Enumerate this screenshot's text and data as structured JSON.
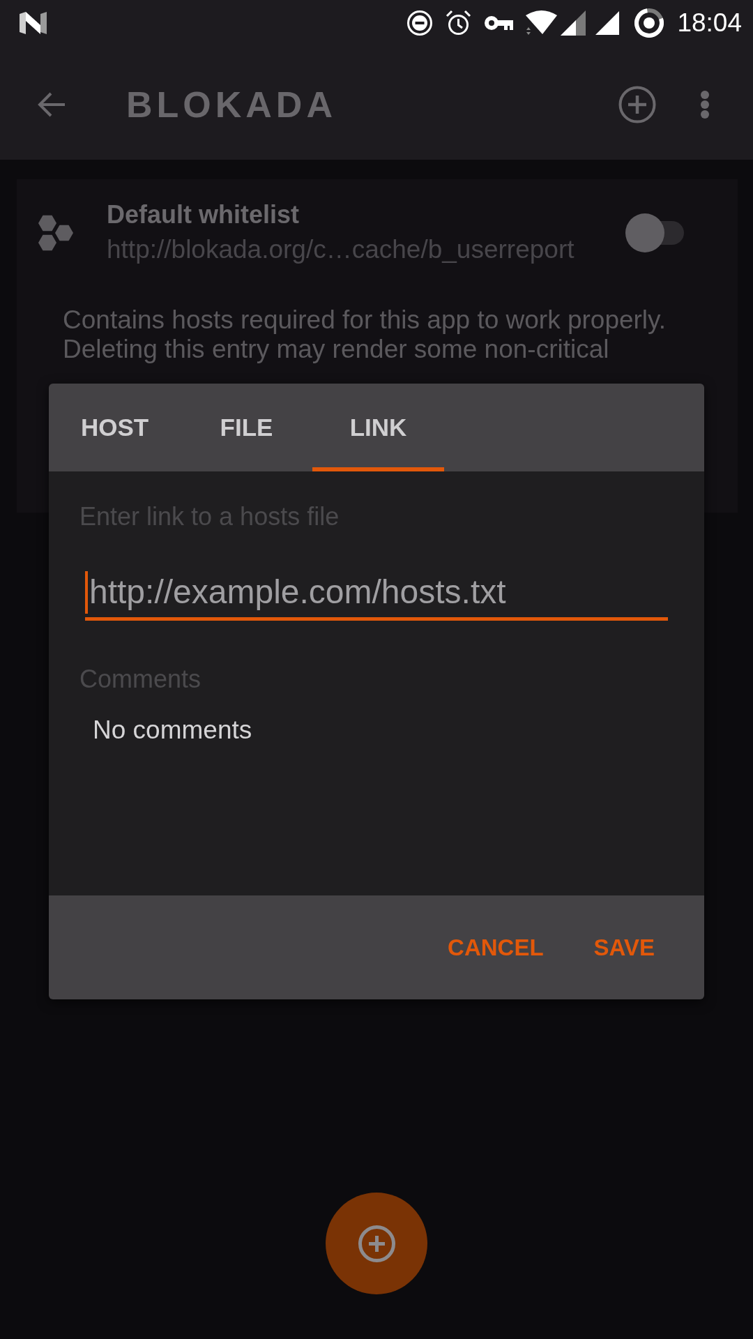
{
  "status_bar": {
    "time": "18:04"
  },
  "app_bar": {
    "title": "BLOKADA"
  },
  "list_item": {
    "title": "Default whitelist",
    "url": "http://blokada.org/c…cache/b_userreport",
    "on": false,
    "description": "Contains hosts required for this app to work properly. Deleting this entry may render some non-critical"
  },
  "dialog": {
    "tabs": [
      {
        "label": "HOST",
        "selected": false
      },
      {
        "label": "FILE",
        "selected": false
      },
      {
        "label": "LINK",
        "selected": true
      }
    ],
    "link_label": "Enter link to a hosts file",
    "link_field": {
      "placeholder": "http://example.com/hosts.txt",
      "focused": true
    },
    "comments_label": "Comments",
    "comments_text": "No comments",
    "buttons": [
      "CANCEL",
      "SAVE"
    ]
  }
}
